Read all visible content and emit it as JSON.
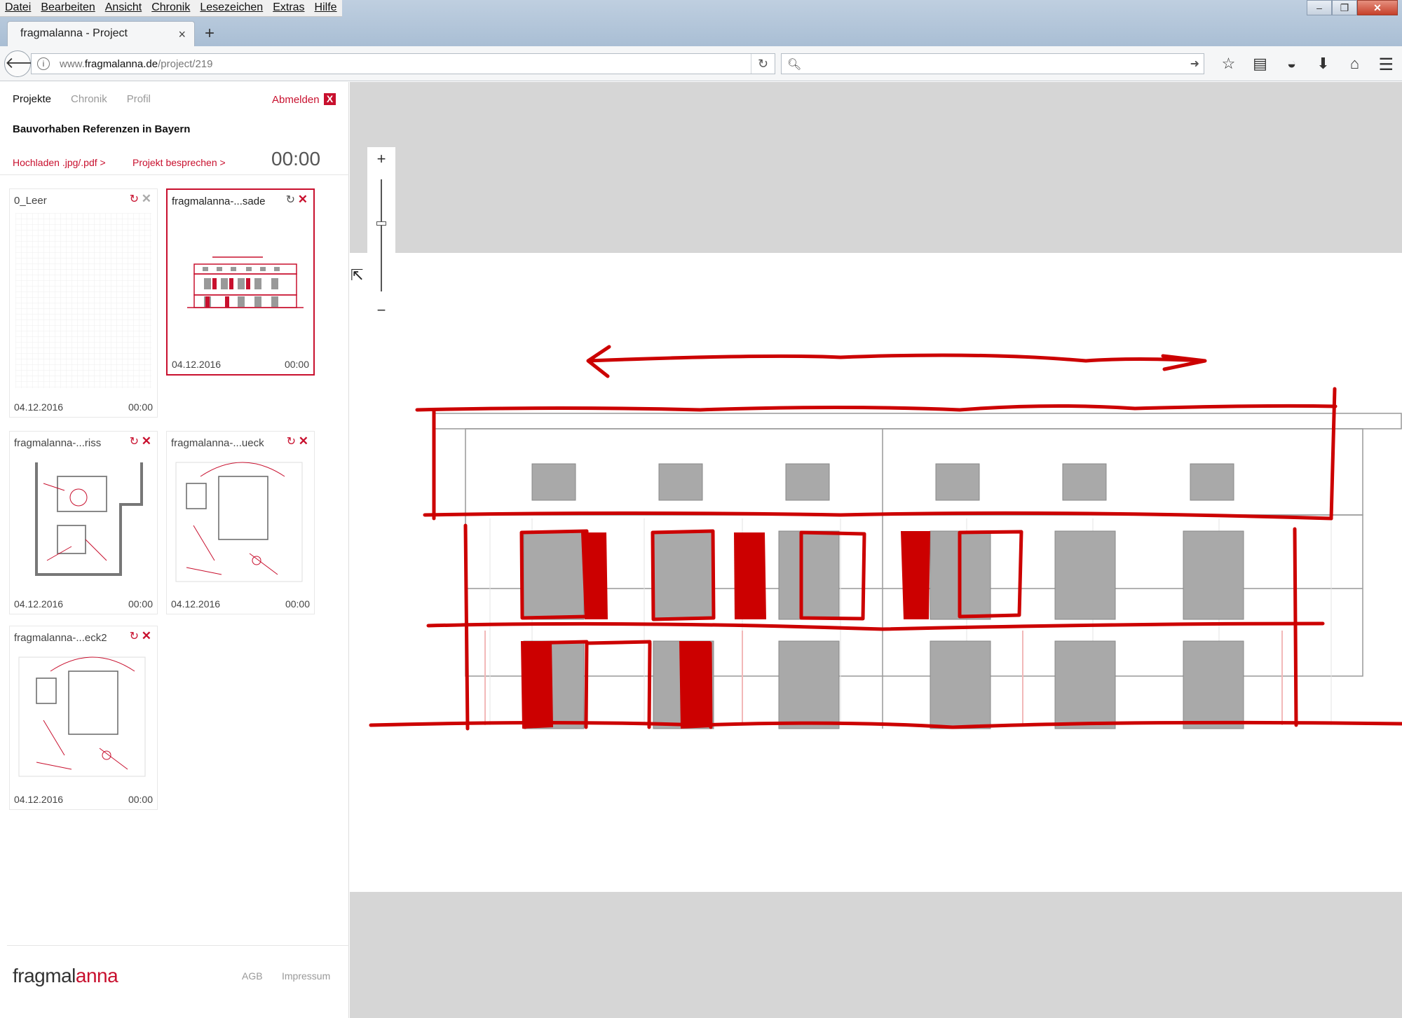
{
  "menu": [
    "Datei",
    "Bearbeiten",
    "Ansicht",
    "Chronik",
    "Lesezeichen",
    "Extras",
    "Hilfe"
  ],
  "tab": {
    "title": "fragmalanna - Project",
    "close": "×",
    "new": "+"
  },
  "address": {
    "prefix": "www.",
    "domain": "fragmalanna.de",
    "path": "/project/219"
  },
  "sidebar": {
    "nav": {
      "projects": "Projekte",
      "history": "Chronik",
      "profile": "Profil"
    },
    "logout": "Abmelden",
    "logout_icon": "X",
    "project_title": "Bauvorhaben Referenzen in Bayern",
    "upload": "Hochladen .jpg/.pdf >",
    "discuss": "Projekt besprechen >",
    "timer": "00:00",
    "cards": [
      {
        "title": "0_Leer",
        "date": "04.12.2016",
        "time": "00:00"
      },
      {
        "title": "fragmalanna-...sade",
        "date": "04.12.2016",
        "time": "00:00"
      },
      {
        "title": "fragmalanna-...riss",
        "date": "04.12.2016",
        "time": "00:00"
      },
      {
        "title": "fragmalanna-...ueck",
        "date": "04.12.2016",
        "time": "00:00"
      },
      {
        "title": "fragmalanna-...eck2",
        "date": "04.12.2016",
        "time": "00:00"
      }
    ],
    "footer": {
      "logo_a": "fragmal",
      "logo_b": "anna",
      "agb": "AGB",
      "impressum": "Impressum"
    }
  },
  "zoom": {
    "plus": "+",
    "minus": "−"
  },
  "colors": {
    "accent": "#c8102e",
    "canvas_bg": "#d6d6d6"
  }
}
